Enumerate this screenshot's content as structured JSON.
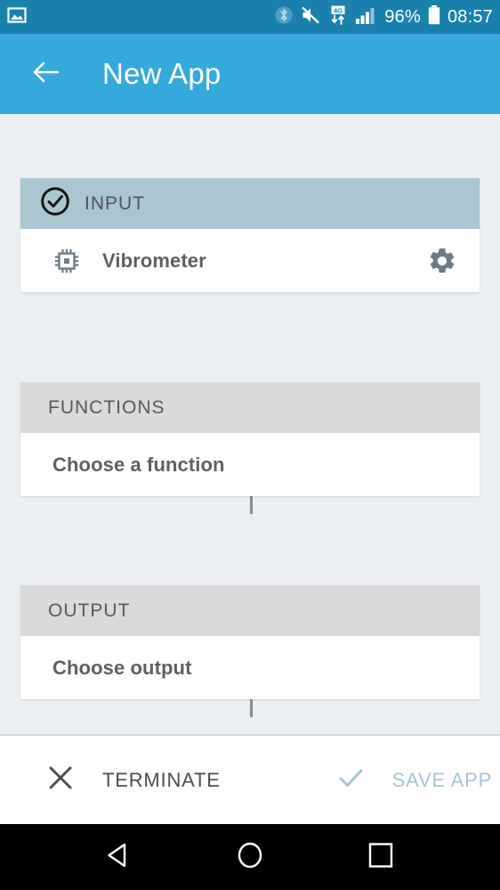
{
  "status_bar": {
    "left_icons": [
      {
        "name": "screenshot-image-icon"
      }
    ],
    "right_icons": [
      {
        "name": "bluetooth-icon"
      },
      {
        "name": "volume-muted-icon"
      },
      {
        "name": "mobile-data-4g-icon",
        "label": "4G"
      },
      {
        "name": "signal-bars-icon"
      }
    ],
    "battery_percent": "96%",
    "clock": "08:57",
    "background": "#1a80ad"
  },
  "app_bar": {
    "back_icon": "arrow-left-icon",
    "title": "New App",
    "background": "#36a9dd",
    "text_color": "#ffffff"
  },
  "flow": {
    "sections": [
      {
        "key": "input",
        "header_label": "INPUT",
        "header_icon": "check-circle-icon",
        "header_state": "active",
        "header_bg": "#a9c6d1",
        "row": {
          "icon": "chip-icon",
          "label": "Vibrometer",
          "action_icon": "gear-icon"
        }
      },
      {
        "key": "functions",
        "header_label": "FUNCTIONS",
        "header_icon": null,
        "header_state": "inactive",
        "header_bg": "#dadada",
        "row": {
          "icon": null,
          "label": "Choose a function",
          "action_icon": null
        }
      },
      {
        "key": "output",
        "header_label": "OUTPUT",
        "header_icon": null,
        "header_state": "inactive",
        "header_bg": "#dadada",
        "row": {
          "icon": null,
          "label": "Choose output",
          "action_icon": null
        }
      }
    ],
    "connector_color": "#7f8f96",
    "page_background": "#eceff1"
  },
  "bottom_bar": {
    "terminate": {
      "icon": "close-x-icon",
      "label": "TERMINATE",
      "color": "#4d4d4d"
    },
    "save_app": {
      "icon": "check-icon",
      "label": "SAVE APP",
      "color": "#a6c5d4"
    }
  },
  "nav_bar": {
    "back_icon": "nav-back-triangle-icon",
    "home_icon": "nav-home-circle-icon",
    "recents_icon": "nav-recents-square-icon",
    "background": "#000000"
  }
}
